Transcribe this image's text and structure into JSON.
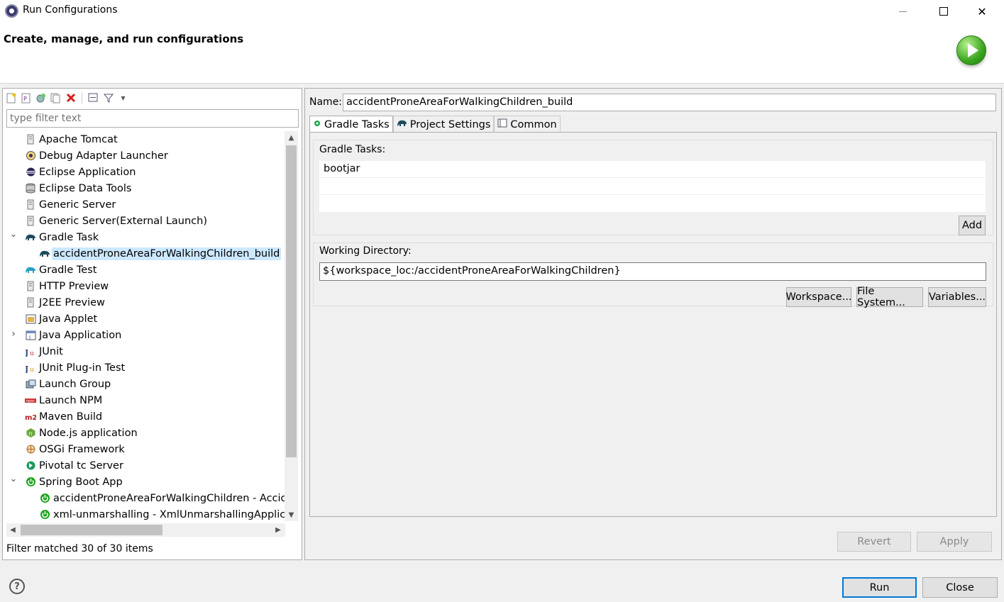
{
  "window": {
    "title": "Run Configurations"
  },
  "header": {
    "heading": "Create, manage, and run configurations"
  },
  "left": {
    "filter_placeholder": "type filter text",
    "status": "Filter matched 30 of 30 items",
    "tree": [
      {
        "label": "Apache Tomcat",
        "icon": "server-icon",
        "expanded": null
      },
      {
        "label": "Debug Adapter Launcher",
        "icon": "debug-adapter-icon",
        "expanded": null
      },
      {
        "label": "Eclipse Application",
        "icon": "eclipse-icon",
        "expanded": null
      },
      {
        "label": "Eclipse Data Tools",
        "icon": "database-icon",
        "expanded": null
      },
      {
        "label": "Generic Server",
        "icon": "server-icon",
        "expanded": null
      },
      {
        "label": "Generic Server(External Launch)",
        "icon": "server-icon",
        "expanded": null
      },
      {
        "label": "Gradle Task",
        "icon": "gradle-elephant-icon",
        "expanded": true
      },
      {
        "label": "accidentProneAreaForWalkingChildren_build",
        "icon": "gradle-elephant-icon",
        "child": true,
        "selected": true
      },
      {
        "label": "Gradle Test",
        "icon": "gradle-test-icon",
        "expanded": null
      },
      {
        "label": "HTTP Preview",
        "icon": "server-icon",
        "expanded": null
      },
      {
        "label": "J2EE Preview",
        "icon": "server-icon",
        "expanded": null
      },
      {
        "label": "Java Applet",
        "icon": "applet-icon",
        "expanded": null
      },
      {
        "label": "Java Application",
        "icon": "java-app-icon",
        "expanded": false
      },
      {
        "label": "JUnit",
        "icon": "junit-icon",
        "expanded": null
      },
      {
        "label": "JUnit Plug-in Test",
        "icon": "junit-plugin-icon",
        "expanded": null
      },
      {
        "label": "Launch Group",
        "icon": "launch-group-icon",
        "expanded": null
      },
      {
        "label": "Launch NPM",
        "icon": "npm-icon",
        "expanded": null
      },
      {
        "label": "Maven Build",
        "icon": "maven-icon",
        "expanded": null
      },
      {
        "label": "Node.js application",
        "icon": "nodejs-icon",
        "expanded": null
      },
      {
        "label": "OSGi Framework",
        "icon": "osgi-icon",
        "expanded": null
      },
      {
        "label": "Pivotal tc Server",
        "icon": "pivotal-icon",
        "expanded": null
      },
      {
        "label": "Spring Boot App",
        "icon": "spring-boot-icon",
        "expanded": true
      },
      {
        "label": "accidentProneAreaForWalkingChildren - Acciden",
        "icon": "spring-boot-icon",
        "child": true
      },
      {
        "label": "xml-unmarshalling - XmlUnmarshallingApplicati",
        "icon": "spring-boot-icon",
        "child": true
      }
    ]
  },
  "right": {
    "name_label": "Name:",
    "name_value": "accidentProneAreaForWalkingChildren_build",
    "tabs": [
      {
        "label": "Gradle Tasks",
        "icon": "gradle-task-tab-icon",
        "active": true
      },
      {
        "label": "Project Settings",
        "icon": "gradle-elephant-icon"
      },
      {
        "label": "Common",
        "icon": "common-tab-icon"
      }
    ],
    "gradle_tasks": {
      "title": "Gradle Tasks:",
      "rows": [
        "bootjar",
        "",
        ""
      ],
      "add_label": "Add"
    },
    "working_dir": {
      "title": "Working Directory:",
      "value": "${workspace_loc:/accidentProneAreaForWalkingChildren}",
      "workspace_label": "Workspace...",
      "filesystem_label": "File System...",
      "variables_label": "Variables..."
    },
    "revert_label": "Revert",
    "apply_label": "Apply"
  },
  "footer": {
    "run_label": "Run",
    "close_label": "Close"
  },
  "colors": {
    "selection": "#cce8ff",
    "primary_border": "#0078d7",
    "run_green": "#3aa51e"
  }
}
